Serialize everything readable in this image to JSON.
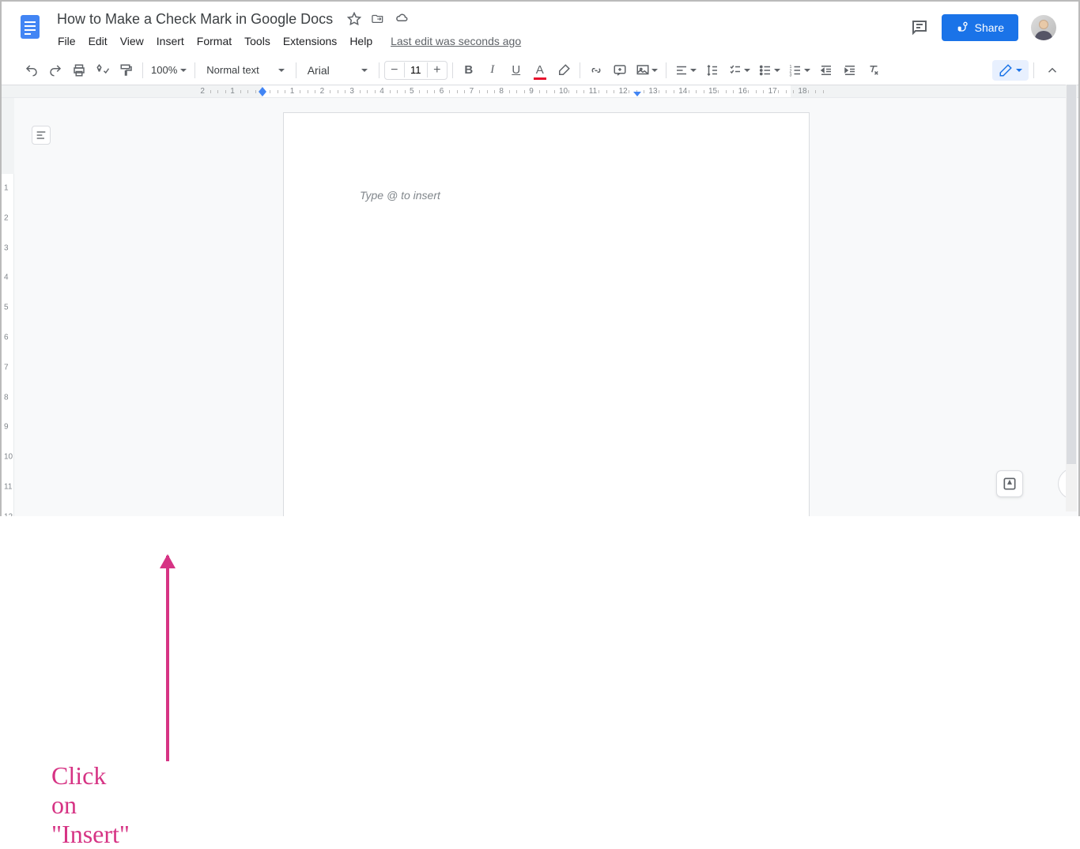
{
  "title": "How to Make a Check Mark in Google Docs",
  "menu": [
    "File",
    "Edit",
    "View",
    "Insert",
    "Format",
    "Tools",
    "Extensions",
    "Help"
  ],
  "last_edit": "Last edit was seconds ago",
  "share_label": "Share",
  "toolbar": {
    "zoom": "100%",
    "style": "Normal text",
    "font": "Arial",
    "font_size": "11"
  },
  "ruler_marks": [
    "2",
    "1",
    "1",
    "2",
    "3",
    "4",
    "5",
    "6",
    "7",
    "8",
    "9",
    "10",
    "11",
    "12",
    "13",
    "14",
    "15"
  ],
  "vruler_marks": [
    "1",
    "2",
    "3",
    "4",
    "5",
    "6",
    "7",
    "8",
    "9",
    "10"
  ],
  "placeholder": "Type @ to insert",
  "annotation_text": "Click on \"Insert\""
}
